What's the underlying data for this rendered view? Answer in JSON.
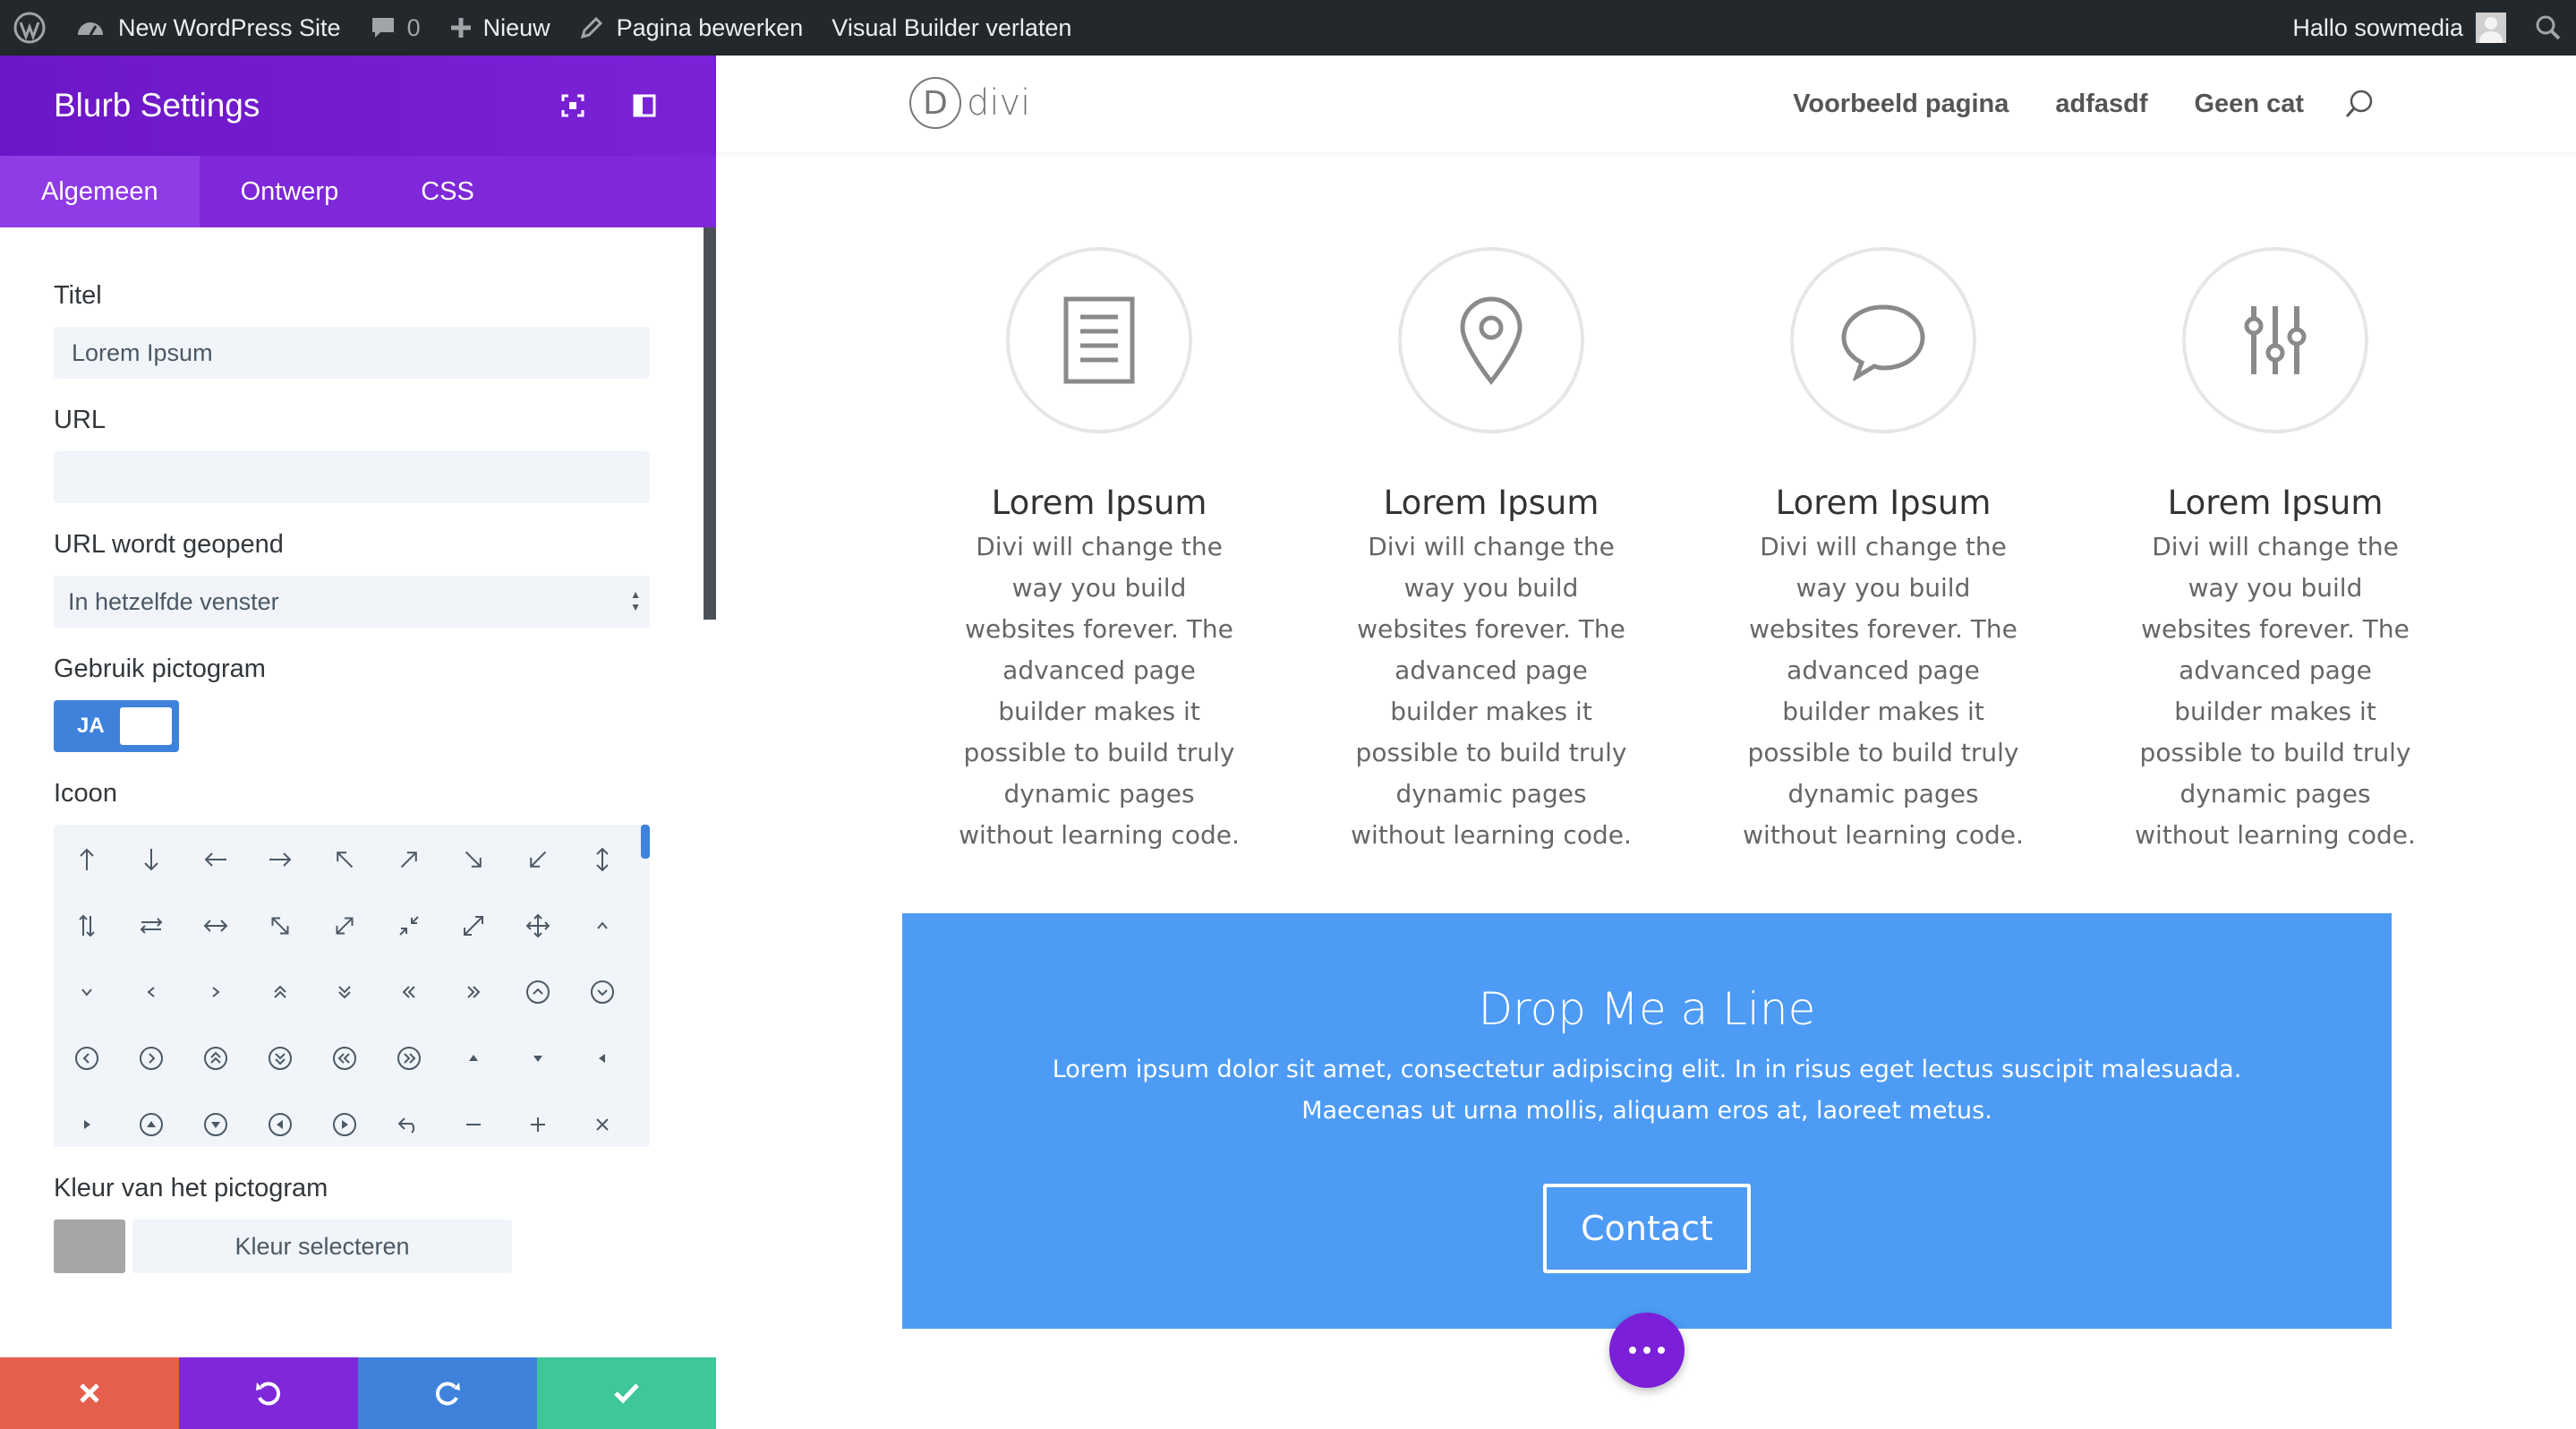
{
  "adminbar": {
    "site_name": "New WordPress Site",
    "comments_count": "0",
    "new_label": "Nieuw",
    "edit_page_label": "Pagina bewerken",
    "exit_builder_label": "Visual Builder verlaten",
    "greeting": "Hallo sowmedia"
  },
  "panel": {
    "title": "Blurb Settings",
    "tabs": [
      {
        "label": "Algemeen",
        "active": true
      },
      {
        "label": "Ontwerp",
        "active": false
      },
      {
        "label": "CSS",
        "active": false
      }
    ],
    "fields": {
      "title_label": "Titel",
      "title_value": "Lorem Ipsum",
      "url_label": "URL",
      "url_value": "",
      "url_target_label": "URL wordt geopend",
      "url_target_value": "In hetzelfde venster",
      "use_icon_label": "Gebruik pictogram",
      "use_icon_value": "JA",
      "icon_label": "Icoon",
      "icon_color_label": "Kleur van het pictogram",
      "icon_color_button": "Kleur selecteren",
      "icon_color_value": "#a6a6a6"
    },
    "footer": {
      "discard_color": "#e65f4e",
      "undo_color": "#7e28d9",
      "redo_color": "#3e82dc",
      "save_color": "#3fc69b"
    }
  },
  "site": {
    "logo_letter": "D",
    "logo_text": "divi",
    "nav": [
      "Voorbeeld pagina",
      "adfasdf",
      "Geen cat"
    ]
  },
  "blurbs": [
    {
      "icon": "document-icon",
      "title": "Lorem Ipsum",
      "text": "Divi will change the way you build websites forever. The advanced page builder makes it possible to build truly dynamic pages without learning code."
    },
    {
      "icon": "map-pin-icon",
      "title": "Lorem Ipsum",
      "text": "Divi will change the way you build websites forever. The advanced page builder makes it possible to build truly dynamic pages without learning code."
    },
    {
      "icon": "chat-bubble-icon",
      "title": "Lorem Ipsum",
      "text": "Divi will change the way you build websites forever. The advanced page builder makes it possible to build truly dynamic pages without learning code."
    },
    {
      "icon": "sliders-icon",
      "title": "Lorem Ipsum",
      "text": "Divi will change the way you build websites forever. The advanced page builder makes it possible to build truly dynamic pages without learning code."
    }
  ],
  "cta": {
    "title": "Drop Me a Line",
    "text": "Lorem ipsum dolor sit amet, consectetur adipiscing elit. In in risus eget lectus suscipit malesuada. Maecenas ut urna mollis, aliquam eros at, laoreet metus.",
    "button": "Contact",
    "background": "#4d9bf5"
  }
}
